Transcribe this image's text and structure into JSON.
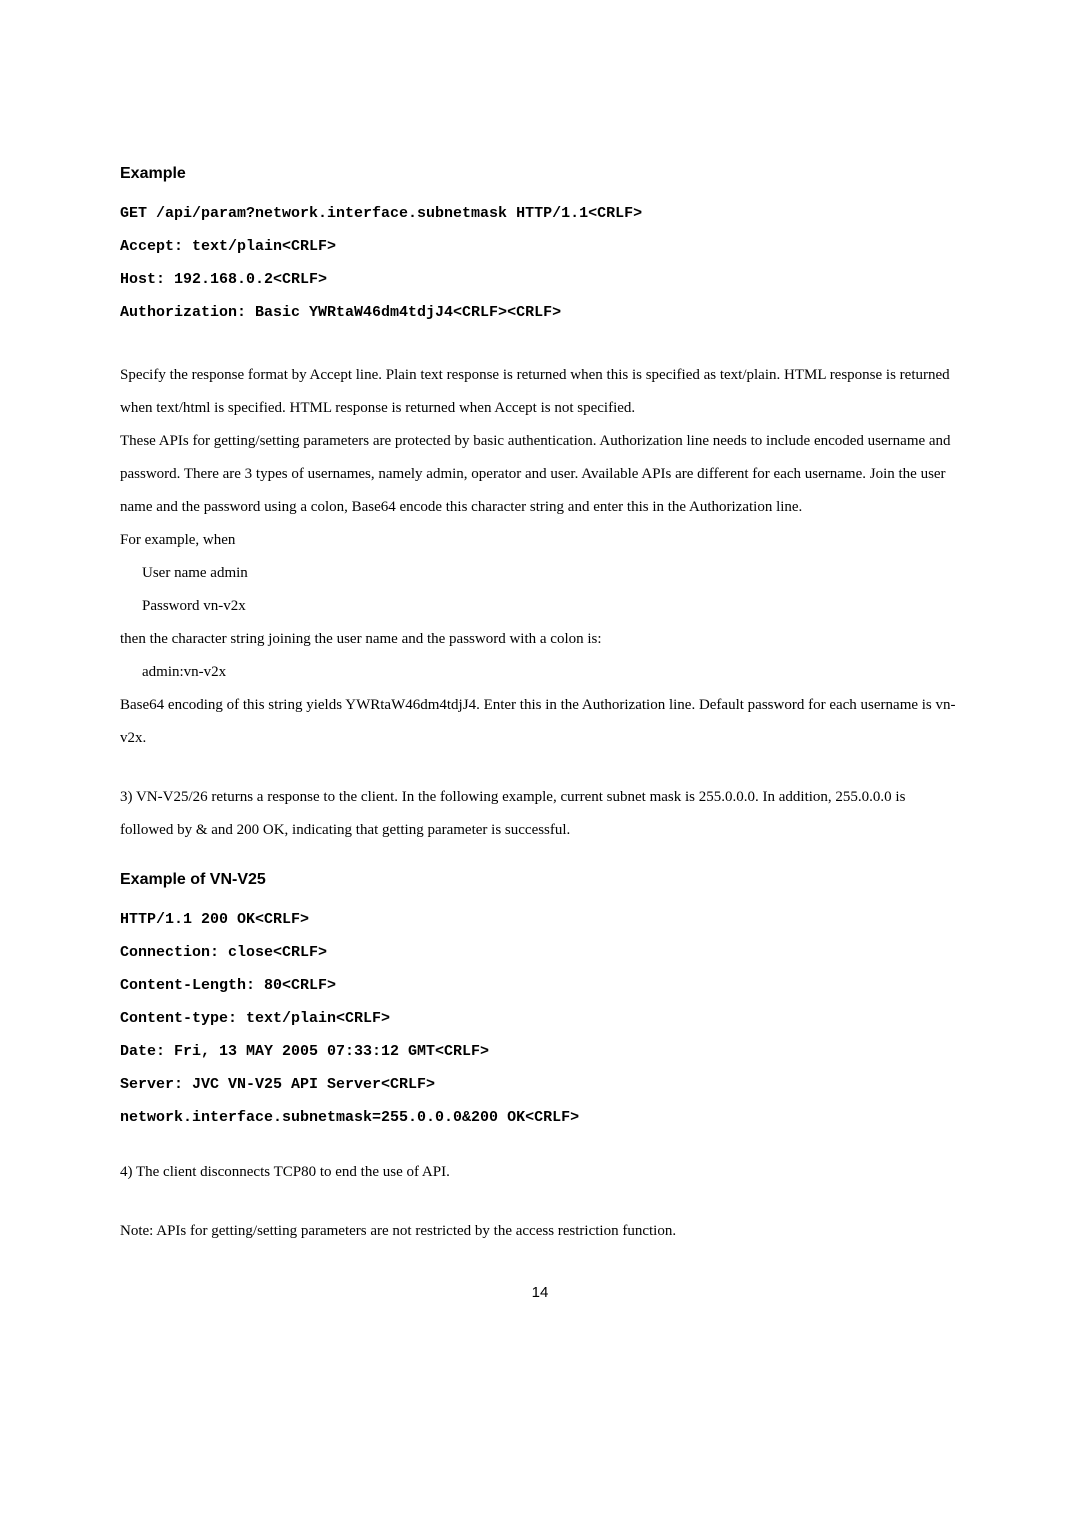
{
  "example1": {
    "heading": "Example",
    "lines": [
      "GET /api/param?network.interface.subnetmask HTTP/1.1<CRLF>",
      "Accept: text/plain<CRLF>",
      "Host: 192.168.0.2<CRLF>",
      "Authorization: Basic YWRtaW46dm4tdjJ4<CRLF><CRLF>"
    ]
  },
  "p1": "Specify the response format by Accept line. Plain text response is returned when this is specified as text/plain. HTML response is returned when text/html is specified. HTML response is returned when Accept is not specified.",
  "p2": "These APIs for getting/setting parameters are protected by basic authentication. Authorization line needs to include encoded username and password. There are 3 types of usernames, namely admin, operator and user. Available APIs are different for each username. Join the user name and the password using a colon, Base64 encode this character string and enter this in the Authorization line.",
  "p3": "For example, when",
  "p3a": "User name   admin",
  "p3b": "Password    vn-v2x",
  "p4": "then the character string joining the user name and the password with a colon is:",
  "p4a": "admin:vn-v2x",
  "p5": "Base64 encoding of this string yields YWRtaW46dm4tdjJ4. Enter this in the Authorization line. Default password for each username is vn-v2x.",
  "p6": "3) VN-V25/26 returns a response to the client. In the following example, current subnet mask is 255.0.0.0. In addition, 255.0.0.0 is followed by & and 200 OK, indicating that getting parameter is successful.",
  "example2": {
    "heading": "Example of VN-V25",
    "lines": [
      "HTTP/1.1 200 OK<CRLF>",
      "Connection: close<CRLF>",
      "Content-Length: 80<CRLF>",
      "Content-type: text/plain<CRLF>",
      "Date: Fri, 13 MAY 2005 07:33:12 GMT<CRLF>",
      "Server: JVC VN-V25 API Server<CRLF>",
      "network.interface.subnetmask=255.0.0.0&200 OK<CRLF>"
    ]
  },
  "p7": "4) The client disconnects TCP80 to end the use of API.",
  "p8": "Note:  APIs for getting/setting parameters are not restricted by the access restriction function.",
  "pageNumber": "14"
}
